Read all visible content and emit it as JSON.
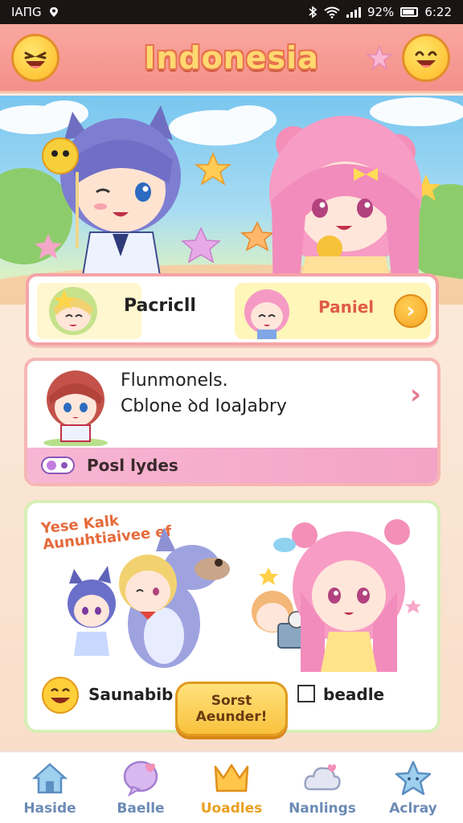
{
  "status_bar": {
    "carrier": "IAΠG",
    "battery": "92%",
    "time": "6:22"
  },
  "header": {
    "title": "Indonesia"
  },
  "card1": {
    "left_label": "Pacricll",
    "right_label": "Paniel"
  },
  "card2": {
    "line1": "Flunmonels.",
    "line2": "Cblone ꝺd IoaJabry",
    "footer_label": "Posl lydes"
  },
  "card3": {
    "speech_line1": "Yese Kalk",
    "speech_line2": "Aunuhtiaivee ef",
    "bottom_left": "Saunabib",
    "bottom_right": "beadle"
  },
  "cta": {
    "line1": "Sorst",
    "line2": "Aeunder!"
  },
  "bottom_nav": {
    "items": [
      {
        "label": "Haside",
        "icon": "home-icon"
      },
      {
        "label": "Baelle",
        "icon": "chat-bubble-icon"
      },
      {
        "label": "Uoadles",
        "icon": "crown-icon",
        "active": true
      },
      {
        "label": "Nanlings",
        "icon": "cloud-heart-icon"
      },
      {
        "label": "Aclray",
        "icon": "star-icon"
      }
    ]
  },
  "colors": {
    "header_bg": "#f48f8a",
    "title_fill": "#ffd870",
    "accent_orange": "#f5a524",
    "active_nav": "#e9a020",
    "inactive_nav": "#6b8bb5"
  }
}
